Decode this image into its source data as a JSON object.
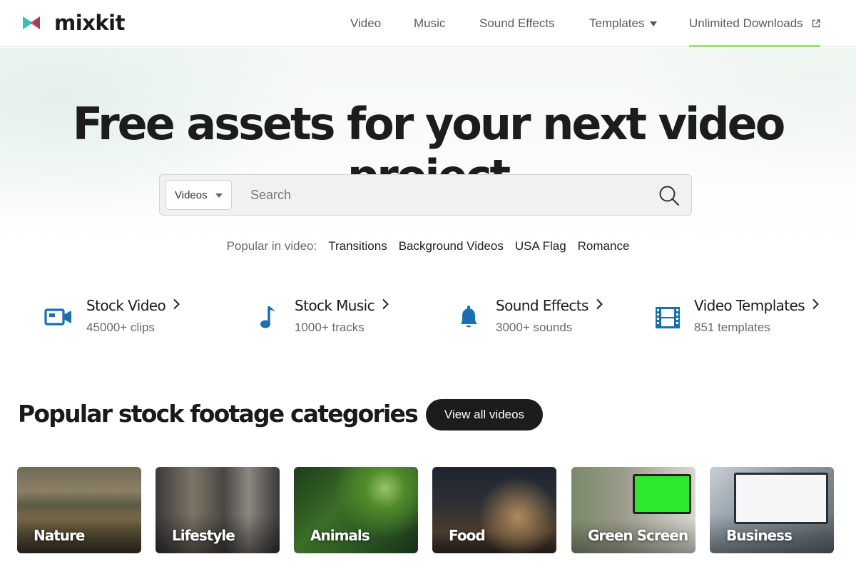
{
  "header": {
    "logo_text": "mixkit",
    "nav": [
      {
        "label": "Video"
      },
      {
        "label": "Music"
      },
      {
        "label": "Sound Effects"
      },
      {
        "label": "Templates"
      },
      {
        "label": "Unlimited Downloads"
      }
    ]
  },
  "hero": {
    "title": "Free assets for your next video project",
    "search": {
      "type_selected": "Videos",
      "placeholder": "Search",
      "value": ""
    },
    "popular": {
      "label": "Popular in video:",
      "links": [
        "Transitions",
        "Background Videos",
        "USA Flag",
        "Romance"
      ]
    }
  },
  "asset_types": [
    {
      "title": "Stock Video",
      "subtitle": "45000+ clips",
      "icon": "video-camera-icon"
    },
    {
      "title": "Stock Music",
      "subtitle": "1000+ tracks",
      "icon": "music-note-icon"
    },
    {
      "title": "Sound Effects",
      "subtitle": "3000+ sounds",
      "icon": "bell-icon"
    },
    {
      "title": "Video Templates",
      "subtitle": "851 templates",
      "icon": "film-strip-icon"
    }
  ],
  "categories": {
    "title": "Popular stock footage categories",
    "view_all_label": "View all videos",
    "items": [
      {
        "label": "Nature"
      },
      {
        "label": "Lifestyle"
      },
      {
        "label": "Animals"
      },
      {
        "label": "Food"
      },
      {
        "label": "Green Screen"
      },
      {
        "label": "Business"
      }
    ]
  },
  "colors": {
    "accent": "#9be27e",
    "icon_blue": "#1a6fb0",
    "button_dark": "#1c1c1c"
  }
}
